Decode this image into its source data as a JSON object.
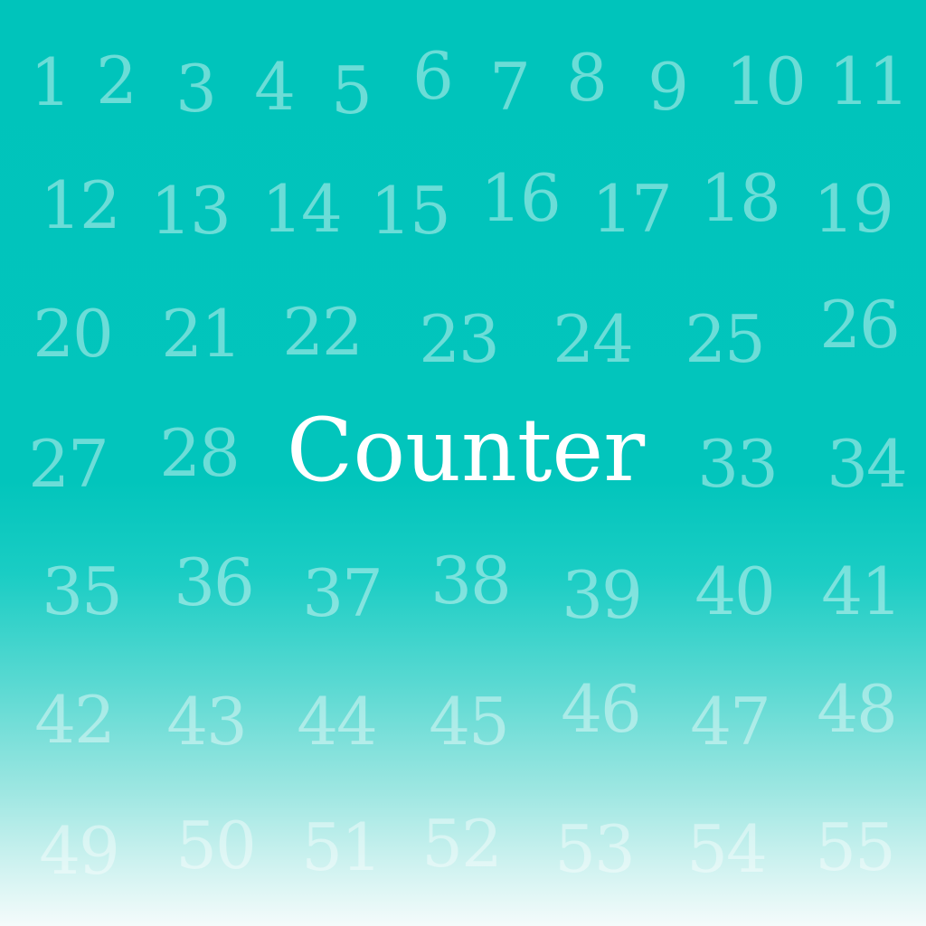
{
  "title": "Counter",
  "colors": {
    "background_top": "#00c4bb",
    "background_bottom": "#f4fbfb",
    "title_color": "#ffffff",
    "number_color": "rgba(255,255,255,0.42)"
  },
  "rows": [
    [
      "1",
      "2",
      "3",
      "4",
      "5",
      "6",
      "7",
      "8",
      "9",
      "10",
      "11"
    ],
    [
      "12",
      "13",
      "14",
      "15",
      "16",
      "17",
      "18",
      "19"
    ],
    [
      "20",
      "21",
      "22",
      "23",
      "24",
      "25",
      "26"
    ],
    [
      "27",
      "28",
      "33",
      "34"
    ],
    [
      "35",
      "36",
      "37",
      "38",
      "39",
      "40",
      "41"
    ],
    [
      "42",
      "43",
      "44",
      "45",
      "46",
      "47",
      "48"
    ],
    [
      "49",
      "50",
      "51",
      "52",
      "53",
      "54",
      "55"
    ]
  ]
}
